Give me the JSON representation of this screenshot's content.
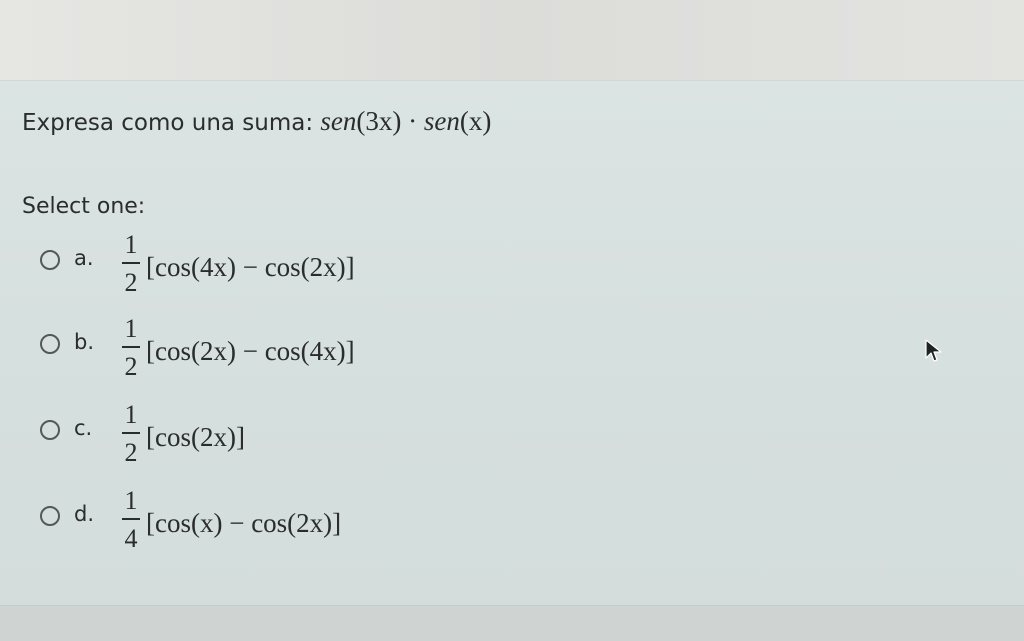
{
  "question": {
    "text": "Expresa como una suma:",
    "math_prefix": "sen",
    "math_arg1": "(3x)",
    "math_dot": " · ",
    "math_suffix": "sen",
    "math_arg2": "(x)"
  },
  "prompt": "Select one:",
  "options": [
    {
      "letter": "a.",
      "numerator": "1",
      "denominator": "2",
      "expression": "[cos(4x) − cos(2x)]"
    },
    {
      "letter": "b.",
      "numerator": "1",
      "denominator": "2",
      "expression": "[cos(2x) − cos(4x)]"
    },
    {
      "letter": "c.",
      "numerator": "1",
      "denominator": "2",
      "expression": "[cos(2x)]"
    },
    {
      "letter": "d.",
      "numerator": "1",
      "denominator": "4",
      "expression": "[cos(x) − cos(2x)]"
    }
  ],
  "cursor_icon": "arrow-cursor-icon"
}
